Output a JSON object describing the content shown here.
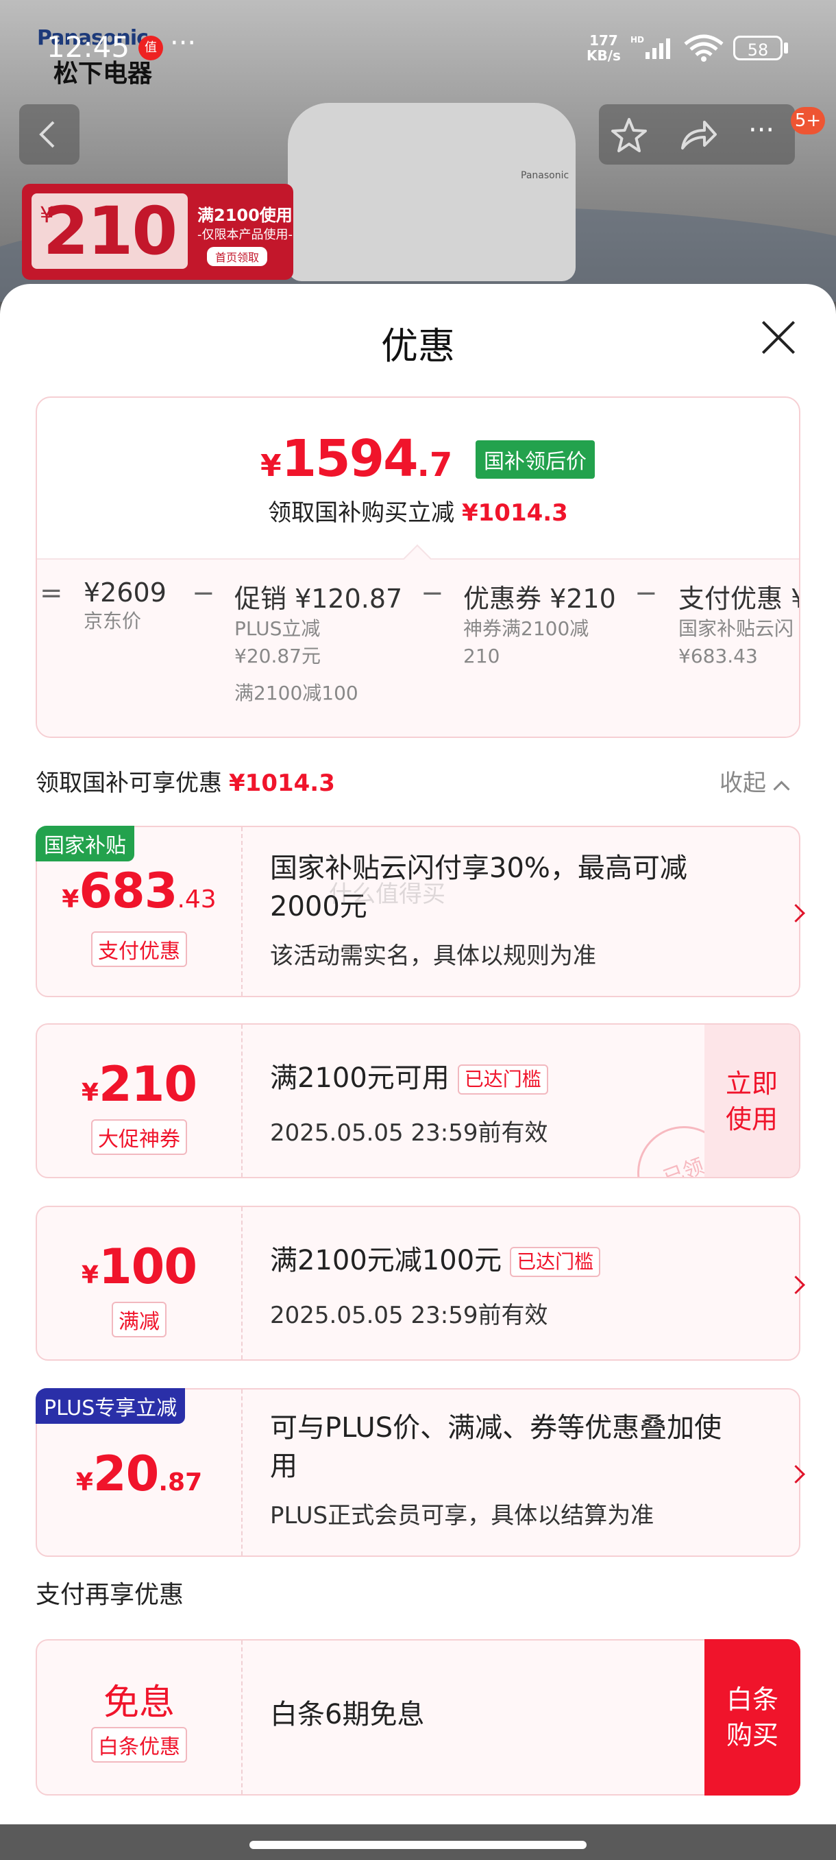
{
  "status_bar": {
    "time": "12:45",
    "app_badge": "值",
    "more": "···",
    "net_speed_value": "177",
    "net_speed_unit": "KB/s",
    "net_type": "HD",
    "battery": "58"
  },
  "background": {
    "brand_logo": "Panasonic",
    "brand_cn": "松下电器",
    "device_brand": "Panasonic",
    "notification_badge": "5+",
    "promo": {
      "yen": "¥",
      "amount": "210",
      "condition": "满2100使用",
      "note": "-仅限本产品使用-",
      "button": "首页领取"
    }
  },
  "sheet": {
    "title": "优惠",
    "price_card": {
      "yen": "¥",
      "final_int": "1594",
      "final_dec": ".7",
      "tag": "国补领后价",
      "save_label": "领取国补购买立减",
      "save_amount": "¥1014.3",
      "formula": {
        "eq": "=",
        "base_price": "¥2609",
        "base_label": "京东价",
        "minus": "−",
        "promo_main": "促销 ¥120.87",
        "promo_sub1": "PLUS立减",
        "promo_sub2": "¥20.87元",
        "promo_sub3": "满2100减100",
        "coupon_main": "优惠券 ¥210",
        "coupon_sub1": "神券满2100减",
        "coupon_sub2": "210",
        "pay_main": "支付优惠 ¥",
        "pay_sub1": "国家补贴云闪",
        "pay_sub2": "¥683.43"
      }
    },
    "section_header": {
      "label": "领取国补可享优惠",
      "amount": "¥1014.3",
      "collapse": "收起"
    },
    "coupons": [
      {
        "corner_tag": "国家补贴",
        "yen": "¥",
        "int": "683",
        "dec": ".43",
        "type": "支付优惠",
        "title": "国家补贴云闪付享30%，最高可减2000元",
        "sub": "该活动需实名，具体以规则为准"
      },
      {
        "yen": "¥",
        "int": "210",
        "type": "大促神券",
        "title": "满2100元可用",
        "chip": "已达门槛",
        "sub": "2025.05.05 23:59前有效",
        "action": "立即使用",
        "stamp": "已领"
      },
      {
        "yen": "¥",
        "int": "100",
        "type": "满减",
        "title": "满2100元减100元",
        "chip": "已达门槛",
        "sub": "2025.05.05 23:59前有效"
      },
      {
        "corner_tag": "PLUS专享立减",
        "yen": "¥",
        "int": "20",
        "dec": ".87",
        "title": "可与PLUS价、满减、券等优惠叠加使用",
        "sub": "PLUS正式会员可享，具体以结算为准"
      }
    ],
    "pay_section_title": "支付再享优惠",
    "pay_offer": {
      "main": "免息",
      "type": "白条优惠",
      "title": "白条6期免息",
      "action": "白条购买"
    },
    "watermark": "什么值得买"
  },
  "colors": {
    "accent_red": "#f0142b",
    "national_tag_green": "#23a24d",
    "plus_blue": "#2a2fa8"
  }
}
